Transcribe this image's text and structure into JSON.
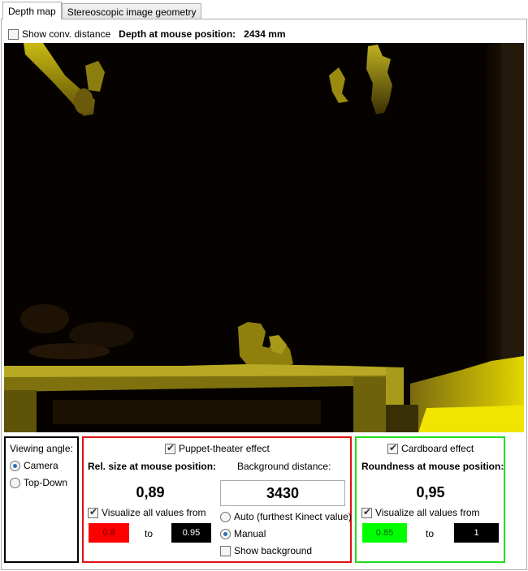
{
  "tabs": [
    {
      "label": "Depth map",
      "active": true
    },
    {
      "label": "Stereoscopic image geometry",
      "active": false
    }
  ],
  "toolbar": {
    "show_conv_label": "Show conv. distance",
    "show_conv_checked": false,
    "depth_label": "Depth at mouse position:",
    "depth_value": "2434 mm"
  },
  "viewing_angle": {
    "title": "Viewing angle:",
    "options": [
      {
        "label": "Camera",
        "selected": true
      },
      {
        "label": "Top-Down",
        "selected": false
      }
    ]
  },
  "puppet": {
    "enable_label": "Puppet-theater effect",
    "enabled": true,
    "rel_size_label": "Rel. size at mouse position:",
    "rel_size_value": "0,89",
    "visualize_label": "Visualize all values from",
    "visualize_checked": true,
    "from_value": "0.8",
    "to_label": "to",
    "to_value": "0.95",
    "from_color": "#ff0000",
    "to_color": "#000000",
    "bg_distance_label": "Background distance:",
    "bg_distance_value": "3430",
    "modes": [
      {
        "label": "Auto (furthest Kinect value)",
        "selected": false
      },
      {
        "label": "Manual",
        "selected": true
      }
    ],
    "show_bg_label": "Show background",
    "show_bg_checked": false
  },
  "cardboard": {
    "enable_label": "Cardboard effect",
    "enabled": true,
    "roundness_label": "Roundness at mouse position:",
    "roundness_value": "0,95",
    "visualize_label": "Visualize all values from",
    "visualize_checked": true,
    "from_value": "0.85",
    "to_label": "to",
    "to_value": "1",
    "from_color": "#00ff00",
    "to_color": "#000000"
  }
}
